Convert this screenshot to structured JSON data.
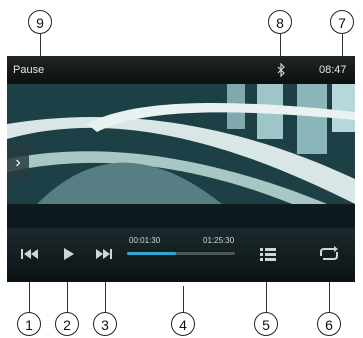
{
  "status": {
    "state": "Pause",
    "clock": "08:47"
  },
  "playback": {
    "elapsed": "00:01:30",
    "total": "01:25:30",
    "progress": 0.45
  },
  "callouts": [
    "1",
    "2",
    "3",
    "4",
    "5",
    "6",
    "7",
    "8",
    "9"
  ],
  "icons": {
    "prev": "skip-previous-icon",
    "play": "play-icon",
    "next": "skip-next-icon",
    "list": "playlist-icon",
    "repeat": "repeat-icon",
    "side": "chevron-right-icon",
    "bluetooth": "bluetooth-icon"
  },
  "colors": {
    "accent": "#2fa7cf",
    "bar": "#0d0f10",
    "text": "#e8e8e8"
  }
}
